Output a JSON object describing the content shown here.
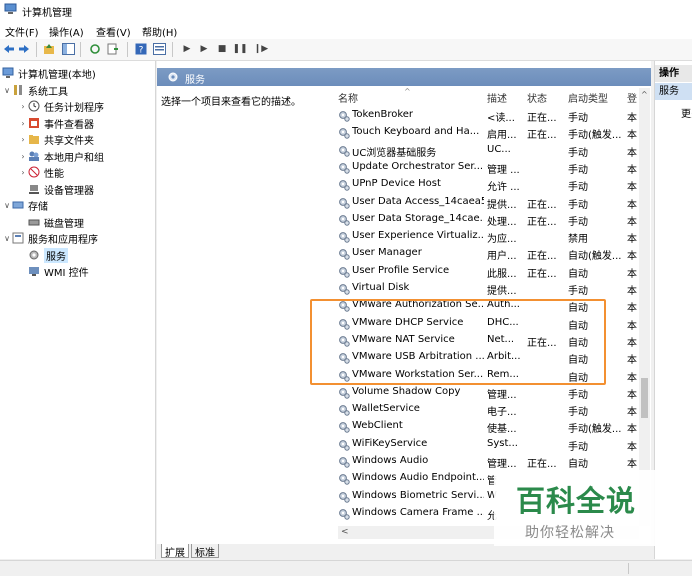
{
  "window": {
    "title": "计算机管理"
  },
  "menu": [
    "文件(F)",
    "操作(A)",
    "查看(V)",
    "帮助(H)"
  ],
  "tree": [
    {
      "label": "计算机管理(本地)",
      "arrow": "",
      "icon": "computer-icon"
    },
    {
      "label": "系统工具",
      "arrow": "∨",
      "icon": "tools-icon"
    },
    {
      "label": "任务计划程序",
      "arrow": "›",
      "icon": "clock-icon"
    },
    {
      "label": "事件查看器",
      "arrow": "›",
      "icon": "event-icon"
    },
    {
      "label": "共享文件夹",
      "arrow": "›",
      "icon": "folder-icon"
    },
    {
      "label": "本地用户和组",
      "arrow": "›",
      "icon": "users-icon"
    },
    {
      "label": "性能",
      "arrow": "›",
      "icon": "performance-icon"
    },
    {
      "label": "设备管理器",
      "arrow": "",
      "icon": "device-icon"
    },
    {
      "label": "存储",
      "arrow": "∨",
      "icon": "storage-icon"
    },
    {
      "label": "磁盘管理",
      "arrow": "",
      "icon": "disk-icon"
    },
    {
      "label": "服务和应用程序",
      "arrow": "∨",
      "icon": "apps-icon"
    },
    {
      "label": "服务",
      "arrow": "",
      "icon": "services-icon"
    },
    {
      "label": "WMI 控件",
      "arrow": "",
      "icon": "wmi-icon"
    }
  ],
  "pane": {
    "title": "服务",
    "description": "选择一个项目来查看它的描述。",
    "columns": {
      "name": "名称",
      "desc": "描述",
      "status": "状态",
      "startup": "启动类型",
      "logon": "登"
    }
  },
  "services": [
    {
      "name": "TokenBroker",
      "desc": "<读...",
      "status": "正在...",
      "startup": "手动",
      "logon": "本"
    },
    {
      "name": "Touch Keyboard and Ha...",
      "desc": "启用...",
      "status": "正在...",
      "startup": "手动(触发...",
      "logon": "本"
    },
    {
      "name": "UC浏览器基础服务",
      "desc": "UC...",
      "status": "",
      "startup": "手动",
      "logon": "本"
    },
    {
      "name": "Update Orchestrator Ser...",
      "desc": "管理 ...",
      "status": "",
      "startup": "手动",
      "logon": "本"
    },
    {
      "name": "UPnP Device Host",
      "desc": "允许 ...",
      "status": "",
      "startup": "手动",
      "logon": "本"
    },
    {
      "name": "User Data Access_14caea5",
      "desc": "提供...",
      "status": "正在...",
      "startup": "手动",
      "logon": "本"
    },
    {
      "name": "User Data Storage_14cae...",
      "desc": "处理...",
      "status": "正在...",
      "startup": "手动",
      "logon": "本"
    },
    {
      "name": "User Experience Virtualiz...",
      "desc": "为应...",
      "status": "",
      "startup": "禁用",
      "logon": "本"
    },
    {
      "name": "User Manager",
      "desc": "用户...",
      "status": "正在...",
      "startup": "自动(触发...",
      "logon": "本"
    },
    {
      "name": "User Profile Service",
      "desc": "此服...",
      "status": "正在...",
      "startup": "自动",
      "logon": "本"
    },
    {
      "name": "Virtual Disk",
      "desc": "提供...",
      "status": "",
      "startup": "手动",
      "logon": "本"
    },
    {
      "name": "VMware Authorization Se...",
      "desc": "Auth...",
      "status": "",
      "startup": "自动",
      "logon": "本"
    },
    {
      "name": "VMware DHCP Service",
      "desc": "DHC...",
      "status": "",
      "startup": "自动",
      "logon": "本"
    },
    {
      "name": "VMware NAT Service",
      "desc": "Net...",
      "status": "正在...",
      "startup": "自动",
      "logon": "本"
    },
    {
      "name": "VMware USB Arbitration ...",
      "desc": "Arbit...",
      "status": "",
      "startup": "自动",
      "logon": "本"
    },
    {
      "name": "VMware Workstation Ser...",
      "desc": "Rem...",
      "status": "",
      "startup": "自动",
      "logon": "本"
    },
    {
      "name": "Volume Shadow Copy",
      "desc": "管理...",
      "status": "",
      "startup": "手动",
      "logon": "本"
    },
    {
      "name": "WalletService",
      "desc": "电子...",
      "status": "",
      "startup": "手动",
      "logon": "本"
    },
    {
      "name": "WebClient",
      "desc": "使基...",
      "status": "",
      "startup": "手动(触发...",
      "logon": "本"
    },
    {
      "name": "WiFiKeyService",
      "desc": "Syst...",
      "status": "",
      "startup": "手动",
      "logon": "本"
    },
    {
      "name": "Windows Audio",
      "desc": "管理...",
      "status": "正在...",
      "startup": "自动",
      "logon": "本"
    },
    {
      "name": "Windows Audio Endpoint...",
      "desc": "管",
      "status": "",
      "startup": "",
      "logon": ""
    },
    {
      "name": "Windows Biometric Servi...",
      "desc": "W",
      "status": "",
      "startup": "",
      "logon": ""
    },
    {
      "name": "Windows Camera Frame ...",
      "desc": "允",
      "status": "",
      "startup": "",
      "logon": ""
    }
  ],
  "tabs": [
    "扩展",
    "标准"
  ],
  "actions": {
    "header": "操作",
    "selected": "服务",
    "more": "更多"
  },
  "watermark": {
    "title": "百科全说",
    "subtitle": "助你轻松解决"
  },
  "colors": {
    "highlight_box": "#f39031",
    "pane_header": "#7493c0",
    "watermark_green": "#2b8a4b"
  }
}
